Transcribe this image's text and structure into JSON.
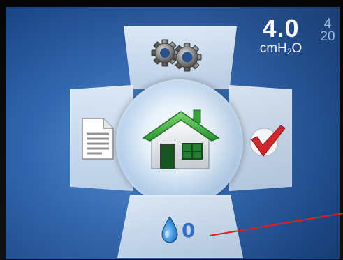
{
  "readout": {
    "value": "4.0",
    "unit_main": "cmH",
    "unit_sub": "2",
    "unit_tail": "O"
  },
  "side_numbers": [
    "4",
    "20"
  ],
  "humidifier": {
    "count": "0"
  },
  "icons": {
    "top": "settings-gears-icon",
    "left": "document-icon",
    "right": "checkmark-icon",
    "center": "home-icon",
    "bottom": "water-drop-icon"
  },
  "colors": {
    "screen": "#2d63ad",
    "tile": "#c9dbef",
    "home_roof": "#3fb63f",
    "check": "#d8232a",
    "annotation_line": "#e02020"
  }
}
